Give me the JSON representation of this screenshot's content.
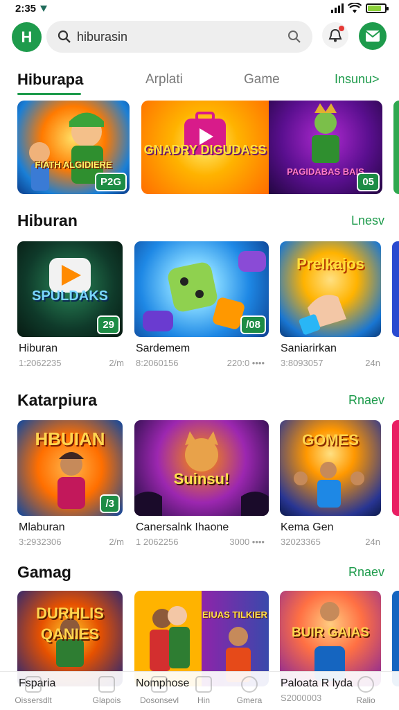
{
  "status": {
    "time": "2:35"
  },
  "search": {
    "value": "hiburasin",
    "placeholder": "hiburasin"
  },
  "logo": {
    "letter": "H"
  },
  "tabs": {
    "items": [
      {
        "label": "Hiburapa"
      },
      {
        "label": "Arplati"
      },
      {
        "label": "Game"
      }
    ],
    "more": "Insunu>"
  },
  "featured": [
    {
      "title": "FIATH ALGIDIERE",
      "badge": "P2G"
    },
    {
      "title": "GNADRY DIGUDASS",
      "badge": ""
    },
    {
      "title": "PAGIDABAS BAIS",
      "badge": "05"
    }
  ],
  "sections": [
    {
      "title": "Hiburan",
      "more": "Lnesv",
      "tiles": [
        {
          "art": "SPULDAKS",
          "badge": "29",
          "name": "Hiburan",
          "id": "1:2062235",
          "meta": "2/m"
        },
        {
          "art": "",
          "badge": "/08",
          "name": "Sardemem",
          "id": "8:2060156",
          "meta": "220:0 ••••"
        },
        {
          "art": "Prelkajos",
          "badge": "",
          "name": "Saniarirkan",
          "id": "3:8093057",
          "meta": "24n"
        }
      ]
    },
    {
      "title": "Katarpiura",
      "more": "Rnaev",
      "tiles": [
        {
          "art": "HBUIAN",
          "badge": "/3",
          "name": "Mlaburan",
          "id": "3:2932306",
          "meta": "2/m"
        },
        {
          "art": "Suinsu!",
          "badge": "",
          "name": "Canersalnk Ihaone",
          "id": "1 2062256",
          "meta": "3000 ••••"
        },
        {
          "art": "GOMES",
          "badge": "",
          "name": "Kema Gen",
          "id": "32023365",
          "meta": "24n"
        }
      ]
    },
    {
      "title": "Gamag",
      "more": "Rnaev",
      "tiles": [
        {
          "art": "DURHLIS QANIES",
          "badge": "",
          "name": "Fsparia",
          "id": "",
          "meta": ""
        },
        {
          "art": "EIUAS TILKIER",
          "badge": "",
          "name": "Nomphose",
          "id": "",
          "meta": ""
        },
        {
          "art": "BUIR GAIAS",
          "badge": "",
          "name": "Paloata R lyda",
          "id": "S2000003",
          "meta": ""
        }
      ]
    }
  ],
  "bottom_nav": [
    {
      "label": "Oissersdlt"
    },
    {
      "label": "Glapois"
    },
    {
      "label": "Dosonsevl"
    },
    {
      "label": "Hin"
    },
    {
      "label": "Gmera"
    },
    {
      "label": "Ralio"
    }
  ],
  "colors": {
    "accent": "#1e9b4c",
    "badge": "#1d8c45"
  }
}
